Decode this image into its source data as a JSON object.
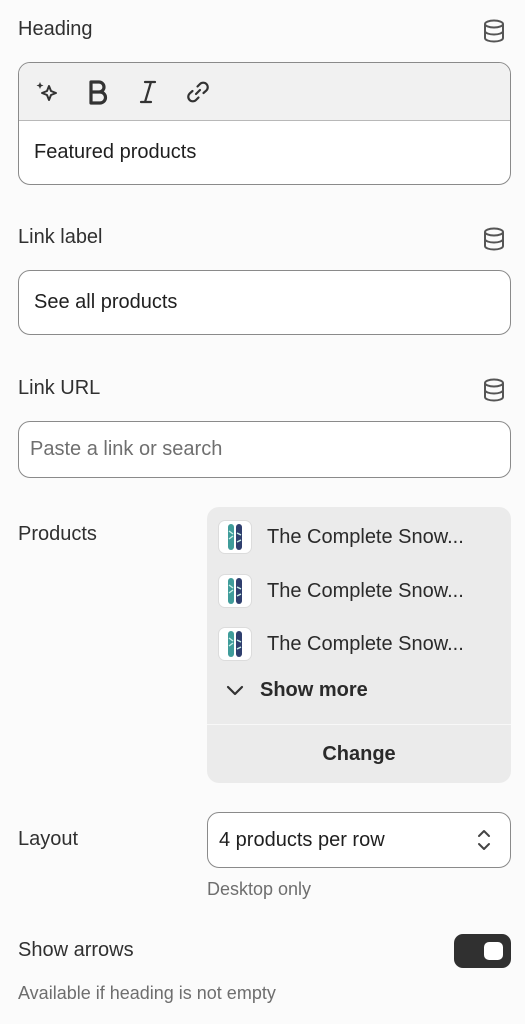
{
  "heading": {
    "label": "Heading",
    "value": "Featured products",
    "toolbar": [
      "sparkle-icon",
      "bold-icon",
      "italic-icon",
      "link-icon"
    ]
  },
  "link_label": {
    "label": "Link label",
    "value": "See all products"
  },
  "link_url": {
    "label": "Link URL",
    "placeholder": "Paste a link or search"
  },
  "products": {
    "label": "Products",
    "items": [
      {
        "name": "The Complete Snow..."
      },
      {
        "name": "The Complete Snow..."
      },
      {
        "name": "The Complete Snow..."
      }
    ],
    "show_more": "Show more",
    "change": "Change"
  },
  "layout": {
    "label": "Layout",
    "value": "4 products per row",
    "help": "Desktop only"
  },
  "show_arrows": {
    "label": "Show arrows",
    "enabled": true,
    "help": "Available if heading is not empty"
  },
  "colors": {
    "text": "#303030",
    "toggle_on": "#303030",
    "picker_bg": "#ebebeb"
  }
}
